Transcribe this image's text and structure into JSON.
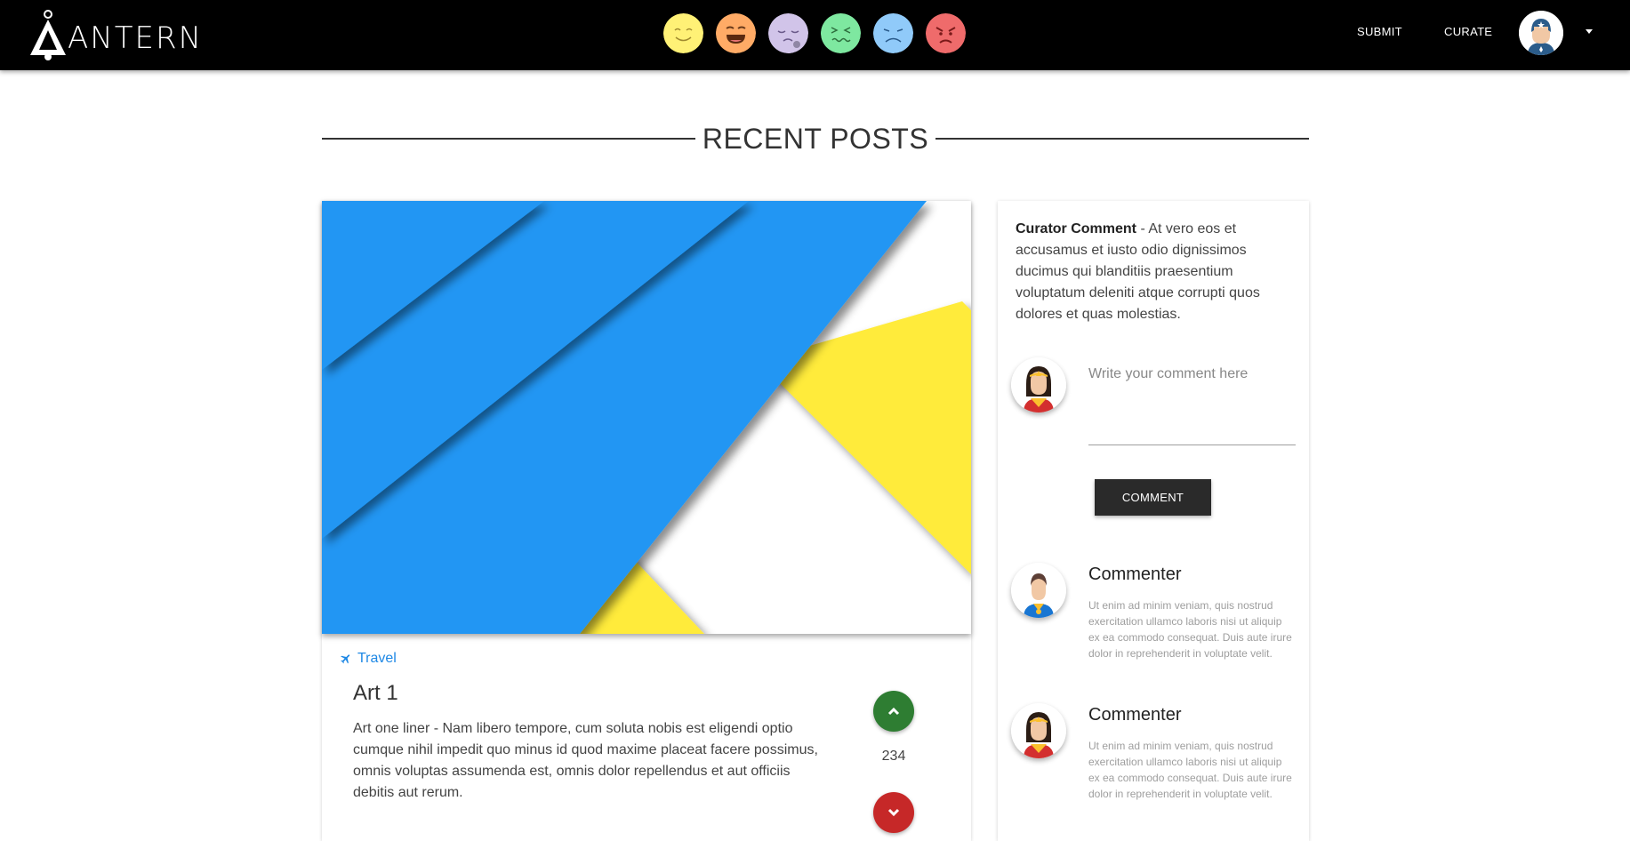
{
  "header": {
    "logo_text": "ANTERN",
    "emotions": [
      {
        "name": "happy",
        "color": "#fff176"
      },
      {
        "name": "laughing",
        "color": "#ffab66"
      },
      {
        "name": "sleepy",
        "color": "#d1c4e9"
      },
      {
        "name": "sick",
        "color": "#7ee8a0"
      },
      {
        "name": "sad",
        "color": "#90caf9"
      },
      {
        "name": "angry",
        "color": "#ef6b6b"
      }
    ],
    "submit_label": "SUBMIT",
    "curate_label": "CURATE"
  },
  "section": {
    "title": "RECENT POSTS"
  },
  "post": {
    "category": "Travel",
    "title": "Art 1",
    "text": "Art one liner - Nam libero tempore, cum soluta nobis est eligendi optio cumque nihil impedit quo minus id quod maxime placeat facere possimus, omnis voluptas assumenda est, omnis dolor repellendus et aut officiis debitis aut rerum.",
    "votes": "234",
    "image_colors": {
      "blue": "#2196f3",
      "yellow": "#ffeb3b",
      "white": "#ffffff"
    }
  },
  "sidebar": {
    "curator_label": "Curator Comment",
    "curator_text": " - At vero eos et accusamus et iusto odio dignissimos ducimus qui blanditiis praesentium voluptatum deleniti atque corrupti quos dolores et quas molestias.",
    "comment_placeholder": "Write your comment here",
    "comment_button": "COMMENT",
    "comments": [
      {
        "name": "Commenter",
        "text": "Ut enim ad minim veniam, quis nostrud exercitation ullamco laboris nisi ut aliquip ex ea commodo consequat. Duis aute irure dolor in reprehenderit in voluptate velit."
      },
      {
        "name": "Commenter",
        "text": "Ut enim ad minim veniam, quis nostrud exercitation ullamco laboris nisi ut aliquip ex ea commodo consequat. Duis aute irure dolor in reprehenderit in voluptate velit."
      }
    ]
  }
}
